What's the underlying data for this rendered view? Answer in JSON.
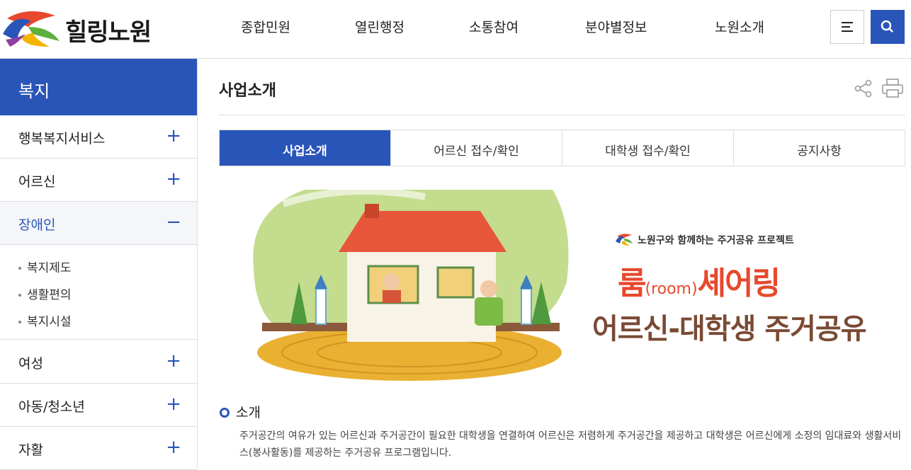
{
  "header": {
    "logo_text": "힐링노원",
    "nav": [
      "종합민원",
      "열린행정",
      "소통참여",
      "분야별정보",
      "노원소개"
    ]
  },
  "sidebar": {
    "title": "복지",
    "items": [
      {
        "label": "행복복지서비스",
        "sign": "+"
      },
      {
        "label": "어르신",
        "sign": "+"
      },
      {
        "label": "장애인",
        "sign": "−"
      },
      {
        "label": "여성",
        "sign": "+"
      },
      {
        "label": "아동/청소년",
        "sign": "+"
      },
      {
        "label": "자활",
        "sign": "+"
      }
    ],
    "sub_items": [
      "복지제도",
      "생활편의",
      "복지시설"
    ]
  },
  "content": {
    "title": "사업소개",
    "tabs": [
      "사업소개",
      "어르신 접수/확인",
      "대학생 접수/확인",
      "공지사항"
    ],
    "banner": {
      "subtitle": "노원구와 함께하는 주거공유 프로젝트",
      "main_a": "룸",
      "main_room": "(room)",
      "main_b": "셰어링",
      "main2": "어르신-대학생 주거공유"
    },
    "section_title": "소개",
    "section_body": "주거공간의 여유가 있는 어르신과 주거공간이 필요한 대학생을 연결하여 어르신은 저렴하게 주거공간을 제공하고 대학생은 어르신에게 소정의 임대료와 생활서비스(봉사활동)를 제공하는 주거공유 프로그램입니다."
  },
  "colors": {
    "accent": "#2a55b8",
    "banner_red": "#e8482d",
    "banner_brown": "#7a4a34"
  }
}
